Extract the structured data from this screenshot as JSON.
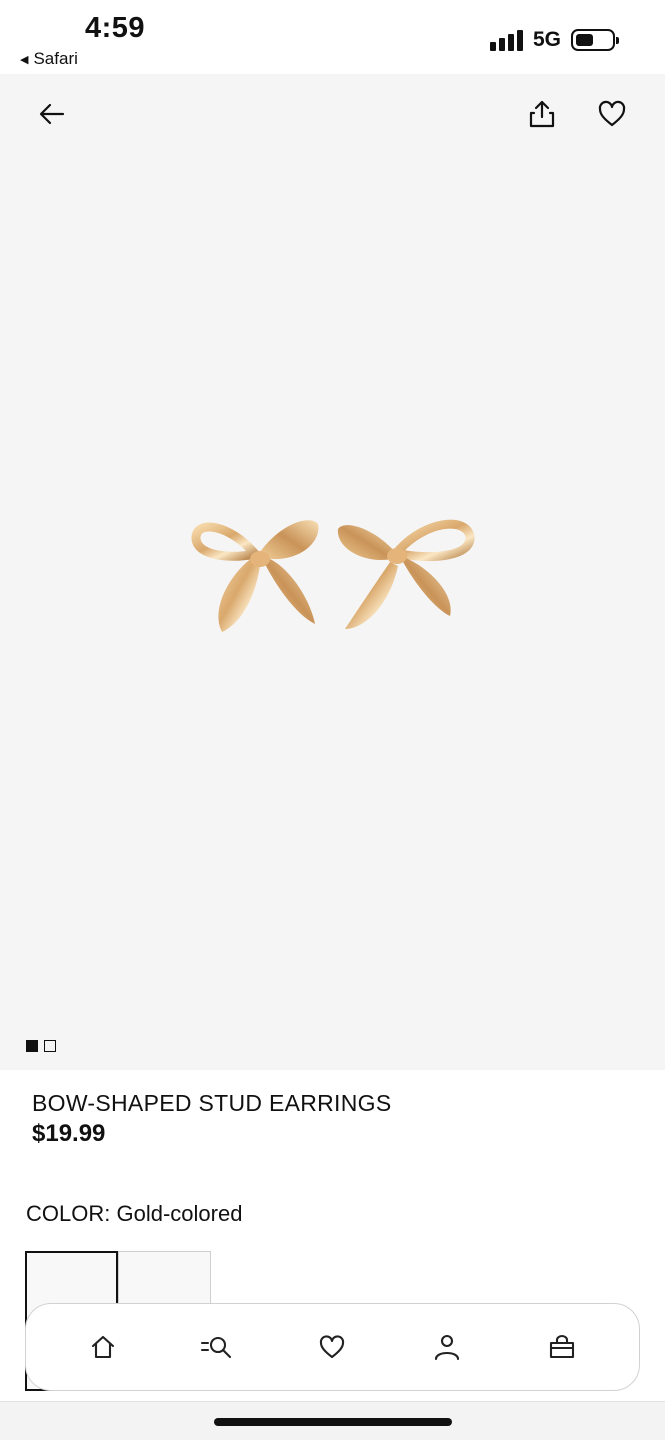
{
  "status_bar": {
    "time": "4:59",
    "back_app": "Safari",
    "network": "5G",
    "battery_level": 0.45
  },
  "header": {
    "icons": [
      "back-arrow-icon",
      "share-icon",
      "heart-icon"
    ]
  },
  "gallery": {
    "image_count": 2,
    "active_index": 0
  },
  "product": {
    "title": "BOW-SHAPED STUD EARRINGS",
    "price": "$19.99",
    "color_label": "COLOR:",
    "color_value": "Gold-colored",
    "accent_color": "#d9a86c"
  },
  "bottom_nav": {
    "items": [
      "home-icon",
      "search-icon",
      "heart-icon",
      "account-icon",
      "bag-icon"
    ]
  }
}
